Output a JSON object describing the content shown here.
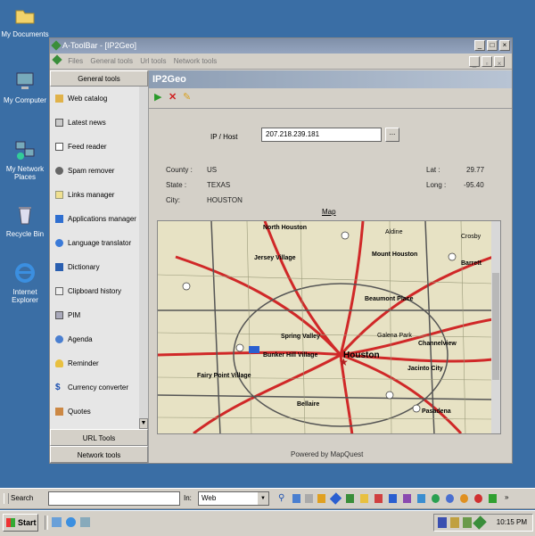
{
  "desktop": {
    "icons": [
      {
        "label": "My Documents",
        "icon": "folder-icon"
      },
      {
        "label": "My Computer",
        "icon": "computer-icon"
      },
      {
        "label": "My Network Places",
        "icon": "network-icon"
      },
      {
        "label": "Recycle Bin",
        "icon": "recycle-bin-icon"
      },
      {
        "label": "Internet Explorer",
        "icon": "ie-icon"
      }
    ]
  },
  "window": {
    "title": "A-ToolBar - [IP2Geo]",
    "menu": [
      "Files",
      "General tools",
      "Url tools",
      "Network tools"
    ]
  },
  "left_panel": {
    "header": "General tools",
    "items": [
      {
        "label": "Web catalog",
        "icon": "book-icon"
      },
      {
        "label": "Latest news",
        "icon": "newspaper-icon"
      },
      {
        "label": "Feed reader",
        "icon": "feed-icon"
      },
      {
        "label": "Spam remover",
        "icon": "scissors-icon"
      },
      {
        "label": "Links manager",
        "icon": "envelope-icon"
      },
      {
        "label": "Applications manager",
        "icon": "apps-icon"
      },
      {
        "label": "Language translator",
        "icon": "globe-icon"
      },
      {
        "label": "Dictionary",
        "icon": "dictionary-icon"
      },
      {
        "label": "Clipboard history",
        "icon": "clipboard-icon"
      },
      {
        "label": "PIM",
        "icon": "pim-icon"
      },
      {
        "label": "Agenda",
        "icon": "agenda-icon"
      },
      {
        "label": "Reminder",
        "icon": "bell-icon"
      },
      {
        "label": "Currency converter",
        "icon": "dollar-icon"
      },
      {
        "label": "Quotes",
        "icon": "quotes-icon"
      }
    ],
    "url_tools": "URL Tools",
    "network_tools": "Network tools"
  },
  "main": {
    "title": "IP2Geo",
    "ip_label": "IP / Host",
    "ip_value": "207.218.239.181",
    "browse": "...",
    "country_label": "County :",
    "country_value": "US",
    "state_label": "State :",
    "state_value": "TEXAS",
    "city_label": "City:",
    "city_value": "HOUSTON",
    "lat_label": "Lat :",
    "lat_value": "29.77",
    "long_label": "Long :",
    "long_value": "-95.40",
    "map_link": "Map",
    "powered_by": "Powered by MapQuest"
  },
  "map": {
    "labels": [
      "North Houston",
      "Aldine",
      "Jersey Village",
      "Mount Houston",
      "Barrett",
      "Crosby",
      "Spring Valley",
      "Houston",
      "Channelview",
      "Jacinto City",
      "Fairy Point Village",
      "Bellaire",
      "Pasadena",
      "Bunker Hill Village",
      "Galena Park",
      "Beaumont Place"
    ]
  },
  "search_bar": {
    "search_label": "Search",
    "search_value": "",
    "in_label": "In:",
    "in_value": "Web"
  },
  "taskbar": {
    "start": "Start",
    "clock": "10:15 PM"
  }
}
